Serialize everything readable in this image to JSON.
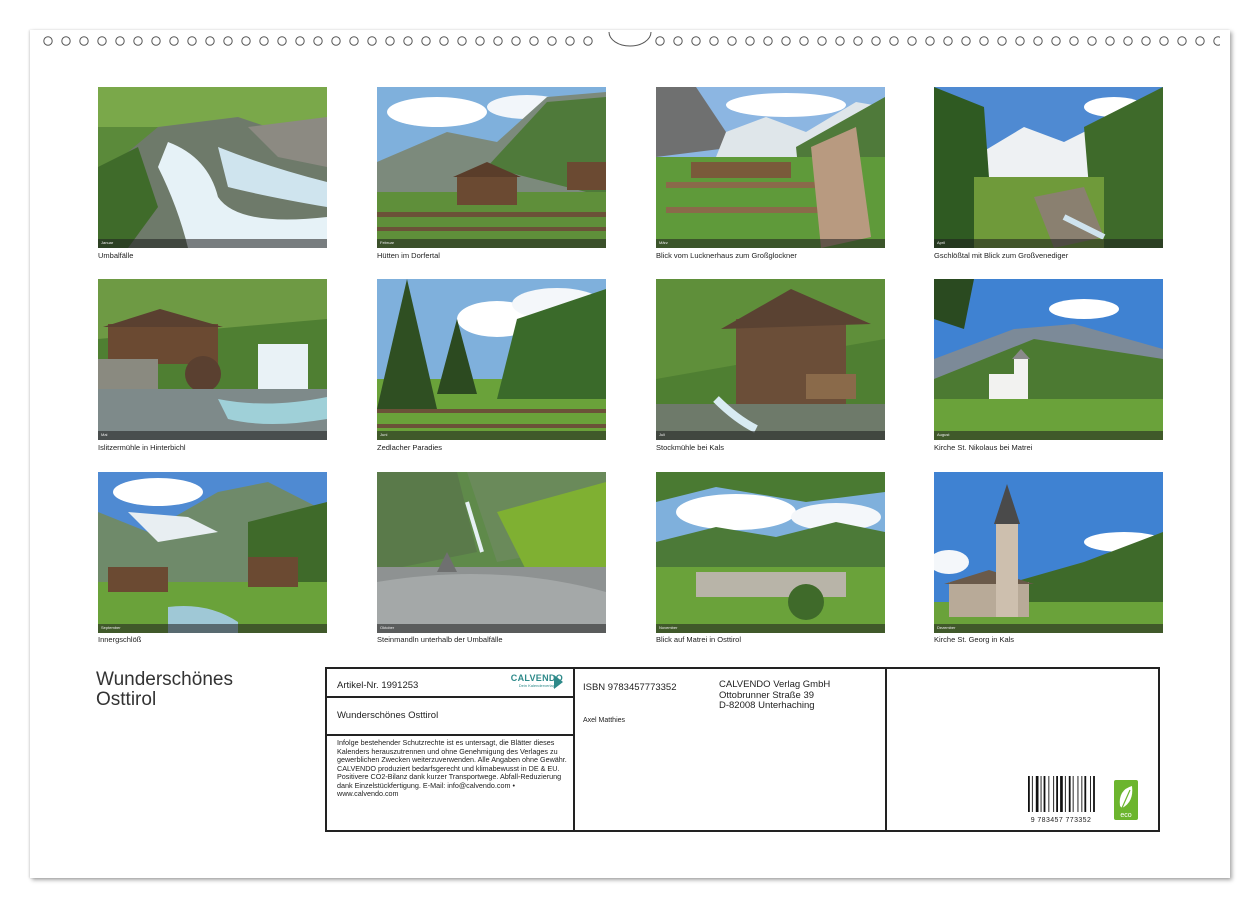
{
  "calendar": {
    "title_line1": "Wunderschönes",
    "title_line2": "Osttirol",
    "images": [
      {
        "caption": "Umbalfälle",
        "month": "Januar"
      },
      {
        "caption": "Hütten im Dorfertal",
        "month": "Februar"
      },
      {
        "caption": "Blick vom Lucknerhaus zum Großglockner",
        "month": "März"
      },
      {
        "caption": "Gschlößtal mit Blick zum Großvenediger",
        "month": "April"
      },
      {
        "caption": "Islitzermühle in Hinterbichl",
        "month": "Mai"
      },
      {
        "caption": "Zedlacher Paradies",
        "month": "Juni"
      },
      {
        "caption": "Stockmühle bei Kals",
        "month": "Juli"
      },
      {
        "caption": "Kirche St. Nikolaus bei Matrei",
        "month": "August"
      },
      {
        "caption": "Innergschlöß",
        "month": "September"
      },
      {
        "caption": "Steinmandln unterhalb der Umbalfälle",
        "month": "Oktober"
      },
      {
        "caption": "Blick auf Matrei in Osttirol",
        "month": "November"
      },
      {
        "caption": "Kirche St. Georg in Kals",
        "month": "Dezember"
      }
    ]
  },
  "infobox": {
    "article": "Artikel-Nr. 1991253",
    "logo": "CALVENDO",
    "logo_sub": "Dein Kalenderverlag",
    "title": "Wunderschönes Osttirol",
    "legal": "Infolge bestehender Schutzrechte ist es untersagt, die Blätter dieses Kalenders herauszutrennen und ohne Genehmigung des Verlages zu gewerblichen Zwecken weiterzuverwenden. Alle Angaben ohne Gewähr. CALVENDO produziert bedarfsgerecht und klimabewusst in DE & EU. Positivere CO2-Bilanz dank kurzer Transportwege. Abfall-Reduzierung dank Einzelstückfertigung. E-Mail: info@calvendo.com • www.calvendo.com",
    "isbn": "ISBN 9783457773352",
    "author": "Axel Matthies",
    "publisher_name": "CALVENDO Verlag GmbH",
    "publisher_street": "Ottobrunner Straße 39",
    "publisher_city": "D-82008 Unterhaching",
    "barcode_number": "9 783457 773352",
    "eco_label": "eco"
  },
  "colors": {
    "calvendo_accent": "#2e8a8a",
    "eco_green": "#6cb52e"
  }
}
